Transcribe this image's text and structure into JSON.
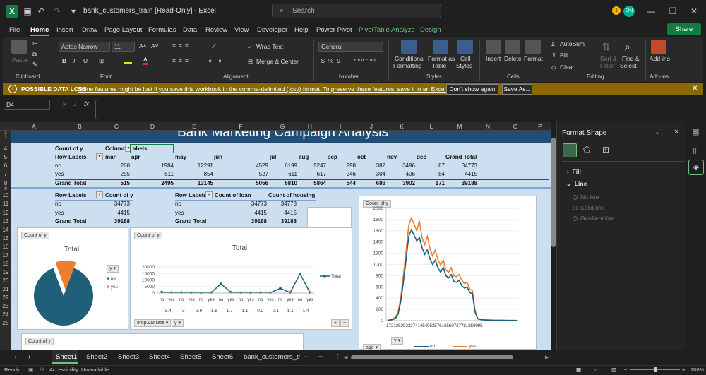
{
  "title_bar": {
    "autosave_label": "AutoSave",
    "doc_title": "bank_customers_train  [Read-Only]  -  Excel",
    "search_placeholder": "Search",
    "avatar_initials": "ON"
  },
  "menu": {
    "tabs": [
      "File",
      "Home",
      "Insert",
      "Draw",
      "Page Layout",
      "Formulas",
      "Data",
      "Review",
      "View",
      "Developer",
      "Help",
      "Power Pivot"
    ],
    "context_tabs": [
      "PivotTable Analyze",
      "Design"
    ],
    "active": "Home",
    "share_label": "Share"
  },
  "ribbon": {
    "clipboard": {
      "paste": "Paste",
      "label": "Clipboard"
    },
    "font": {
      "name": "Aptos Narrow",
      "size": "11",
      "label": "Font"
    },
    "alignment": {
      "wrap": "Wrap Text",
      "merge": "Merge & Center",
      "label": "Alignment"
    },
    "number": {
      "format": "General",
      "label": "Number"
    },
    "styles": {
      "conditional": "Conditional",
      "conditional2": "Formatting",
      "format_table": "Format as",
      "format_table2": "Table",
      "cell_styles": "Cell",
      "cell_styles2": "Styles",
      "label": "Styles"
    },
    "cells": {
      "insert": "Insert",
      "delete": "Delete",
      "format": "Format",
      "label": "Cells"
    },
    "editing": {
      "autosum": "AutoSum",
      "fill": "Fill",
      "clear": "Clear",
      "sort": "Sort &",
      "sort2": "Filter",
      "find": "Find &",
      "find2": "Select",
      "label": "Editing"
    },
    "addins": {
      "addins": "Add-ins",
      "label": "Add-ins"
    }
  },
  "info_bar": {
    "title": "POSSIBLE DATA LOSS",
    "message": "Some features might be lost if you save this workbook in the comma-delimited (.csv) format. To preserve these features, save it in an Excel file format.",
    "dont_show": "Don't show again",
    "save_as": "Save As..."
  },
  "formula_bar": {
    "name_box": "D4",
    "fx": "fx",
    "value": ""
  },
  "columns": [
    "A",
    "B",
    "C",
    "D",
    "E",
    "F",
    "G",
    "H",
    "I",
    "J",
    "K",
    "L",
    "M",
    "N",
    "O",
    "P"
  ],
  "rows": [
    "2",
    "3",
    "4",
    "5",
    "6",
    "7",
    "8",
    "9",
    "10",
    "11",
    "12",
    "13",
    "14",
    "15",
    "16",
    "17",
    "18",
    "19",
    "20",
    "21",
    "22",
    "23",
    "24",
    "25"
  ],
  "sheet_title": "Bank Marketing Campaign Analysis",
  "pivot1": {
    "value_label": "Count of y",
    "col_labels": "Column Labels",
    "row_labels": "Row Labels",
    "months": [
      "mar",
      "apr",
      "may",
      "jun",
      "jul",
      "aug",
      "sep",
      "oct",
      "nov",
      "dec",
      "Grand Total"
    ],
    "rows": [
      {
        "label": "no",
        "values": [
          "260",
          "1984",
          "12291",
          "4529",
          "6199",
          "5247",
          "298",
          "382",
          "3496",
          "87",
          "34773"
        ]
      },
      {
        "label": "yes",
        "values": [
          "255",
          "511",
          "854",
          "527",
          "611",
          "617",
          "246",
          "304",
          "406",
          "84",
          "4415"
        ]
      },
      {
        "label": "Grand Total",
        "values": [
          "515",
          "2495",
          "13145",
          "5056",
          "6810",
          "5864",
          "544",
          "686",
          "3902",
          "171",
          "39188"
        ]
      }
    ]
  },
  "pivot2": {
    "row_labels": "Row Labels",
    "value_label": "Count of y",
    "rows": [
      {
        "label": "no",
        "value": "34773"
      },
      {
        "label": "yes",
        "value": "4415"
      },
      {
        "label": "Grand Total",
        "value": "39188"
      }
    ]
  },
  "pivot3": {
    "row_labels": "Row Labels",
    "loan_label": "Count of loan",
    "housing_label": "Count of housing",
    "rows": [
      {
        "label": "no",
        "loan": "34773",
        "housing": "34773"
      },
      {
        "label": "yes",
        "loan": "4415",
        "housing": "4415"
      },
      {
        "label": "Grand Total",
        "loan": "39188",
        "housing": "39188"
      }
    ]
  },
  "chart_data": [
    {
      "type": "pie",
      "field_button": "Count of y",
      "title": "Total",
      "legend_field": "y",
      "categories": [
        "no",
        "yes"
      ],
      "values": [
        34773,
        4415
      ],
      "colors": [
        "#1f5f7a",
        "#ef7d31"
      ]
    },
    {
      "type": "line",
      "field_button": "Count of y",
      "title": "Total",
      "series": [
        {
          "name": "Total",
          "values": [
            800,
            400,
            400,
            300,
            200,
            400,
            7000,
            600,
            300,
            300,
            350,
            300,
            3600,
            400,
            14700,
            400
          ]
        }
      ],
      "x_inner": [
        "no",
        "yes",
        "no",
        "yes",
        "no",
        "yes",
        "no",
        "yes",
        "no",
        "yes",
        "no",
        "yes",
        "no",
        "yes",
        "no",
        "yes"
      ],
      "x_outer": [
        "-3.4",
        "-3",
        "-2.9",
        "-1.8",
        "-1.7",
        "-1.1",
        "-0.2",
        "-0.1",
        "1.1",
        "1.4"
      ],
      "y_ticks": [
        "20000",
        "15000",
        "10000",
        "5000",
        "0"
      ],
      "ylim": [
        0,
        20000
      ],
      "axis_buttons": [
        "emp.var.rate",
        "y"
      ],
      "color": "#1f5f7a"
    },
    {
      "type": "line",
      "field_button": "Count of y",
      "series": [
        {
          "name": "no",
          "color": "#1f5f7a",
          "values": [
            5,
            10,
            20,
            40,
            120,
            350,
            700,
            1100,
            1500,
            1620,
            1520,
            1420,
            1480,
            1300,
            1180,
            1260,
            1100,
            1000,
            1080,
            940,
            860,
            950,
            800,
            760,
            820,
            700,
            680,
            720,
            620,
            580,
            600,
            500,
            480,
            150,
            30,
            20,
            15,
            10,
            10,
            8,
            6,
            5,
            5,
            5,
            4,
            4,
            3,
            3,
            3,
            3
          ]
        },
        {
          "name": "yes",
          "color": "#ef7d31",
          "values": [
            8,
            15,
            30,
            60,
            160,
            420,
            820,
            1250,
            1700,
            1830,
            1720,
            1600,
            1780,
            1480,
            1350,
            1500,
            1280,
            1150,
            1260,
            1080,
            990,
            1080,
            900,
            860,
            940,
            800,
            780,
            820,
            720,
            660,
            680,
            560,
            540,
            180,
            40,
            25,
            20,
            15,
            12,
            10,
            9,
            8,
            8,
            7,
            6,
            6,
            5,
            5,
            5,
            5
          ]
        }
      ],
      "y_ticks": [
        "2000",
        "1800",
        "1600",
        "1400",
        "1200",
        "1000",
        "800",
        "600",
        "400",
        "200",
        "0"
      ],
      "ylim": [
        0,
        2000
      ],
      "x_label_text": "1721252933374145495357616569737781858995",
      "axis_buttons": [
        "age",
        "y"
      ],
      "legend": [
        "no",
        "yes"
      ]
    }
  ],
  "format_pane": {
    "title": "Format Shape",
    "fill": "Fill",
    "line": "Line",
    "line_options": [
      "No line",
      "Solid line",
      "Gradient line"
    ]
  },
  "sheet_tabs": [
    "Sheet1",
    "Sheet2",
    "Sheet3",
    "Sheet4",
    "Sheet5",
    "Sheet6",
    "bank_customers_tra"
  ],
  "status": {
    "ready": "Ready",
    "accessibility": "Accessibility: Unavailable",
    "zoom": "100%"
  }
}
